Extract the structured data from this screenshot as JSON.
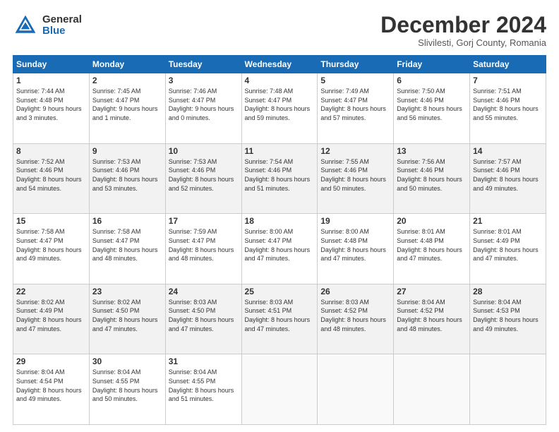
{
  "logo": {
    "general": "General",
    "blue": "Blue"
  },
  "header": {
    "month": "December 2024",
    "location": "Slivilesti, Gorj County, Romania"
  },
  "weekdays": [
    "Sunday",
    "Monday",
    "Tuesday",
    "Wednesday",
    "Thursday",
    "Friday",
    "Saturday"
  ],
  "weeks": [
    [
      {
        "day": "1",
        "sunrise": "7:44 AM",
        "sunset": "4:48 PM",
        "daylight": "9 hours and 3 minutes."
      },
      {
        "day": "2",
        "sunrise": "7:45 AM",
        "sunset": "4:47 PM",
        "daylight": "9 hours and 1 minute."
      },
      {
        "day": "3",
        "sunrise": "7:46 AM",
        "sunset": "4:47 PM",
        "daylight": "9 hours and 0 minutes."
      },
      {
        "day": "4",
        "sunrise": "7:48 AM",
        "sunset": "4:47 PM",
        "daylight": "8 hours and 59 minutes."
      },
      {
        "day": "5",
        "sunrise": "7:49 AM",
        "sunset": "4:47 PM",
        "daylight": "8 hours and 57 minutes."
      },
      {
        "day": "6",
        "sunrise": "7:50 AM",
        "sunset": "4:46 PM",
        "daylight": "8 hours and 56 minutes."
      },
      {
        "day": "7",
        "sunrise": "7:51 AM",
        "sunset": "4:46 PM",
        "daylight": "8 hours and 55 minutes."
      }
    ],
    [
      {
        "day": "8",
        "sunrise": "7:52 AM",
        "sunset": "4:46 PM",
        "daylight": "8 hours and 54 minutes."
      },
      {
        "day": "9",
        "sunrise": "7:53 AM",
        "sunset": "4:46 PM",
        "daylight": "8 hours and 53 minutes."
      },
      {
        "day": "10",
        "sunrise": "7:53 AM",
        "sunset": "4:46 PM",
        "daylight": "8 hours and 52 minutes."
      },
      {
        "day": "11",
        "sunrise": "7:54 AM",
        "sunset": "4:46 PM",
        "daylight": "8 hours and 51 minutes."
      },
      {
        "day": "12",
        "sunrise": "7:55 AM",
        "sunset": "4:46 PM",
        "daylight": "8 hours and 50 minutes."
      },
      {
        "day": "13",
        "sunrise": "7:56 AM",
        "sunset": "4:46 PM",
        "daylight": "8 hours and 50 minutes."
      },
      {
        "day": "14",
        "sunrise": "7:57 AM",
        "sunset": "4:46 PM",
        "daylight": "8 hours and 49 minutes."
      }
    ],
    [
      {
        "day": "15",
        "sunrise": "7:58 AM",
        "sunset": "4:47 PM",
        "daylight": "8 hours and 49 minutes."
      },
      {
        "day": "16",
        "sunrise": "7:58 AM",
        "sunset": "4:47 PM",
        "daylight": "8 hours and 48 minutes."
      },
      {
        "day": "17",
        "sunrise": "7:59 AM",
        "sunset": "4:47 PM",
        "daylight": "8 hours and 48 minutes."
      },
      {
        "day": "18",
        "sunrise": "8:00 AM",
        "sunset": "4:47 PM",
        "daylight": "8 hours and 47 minutes."
      },
      {
        "day": "19",
        "sunrise": "8:00 AM",
        "sunset": "4:48 PM",
        "daylight": "8 hours and 47 minutes."
      },
      {
        "day": "20",
        "sunrise": "8:01 AM",
        "sunset": "4:48 PM",
        "daylight": "8 hours and 47 minutes."
      },
      {
        "day": "21",
        "sunrise": "8:01 AM",
        "sunset": "4:49 PM",
        "daylight": "8 hours and 47 minutes."
      }
    ],
    [
      {
        "day": "22",
        "sunrise": "8:02 AM",
        "sunset": "4:49 PM",
        "daylight": "8 hours and 47 minutes."
      },
      {
        "day": "23",
        "sunrise": "8:02 AM",
        "sunset": "4:50 PM",
        "daylight": "8 hours and 47 minutes."
      },
      {
        "day": "24",
        "sunrise": "8:03 AM",
        "sunset": "4:50 PM",
        "daylight": "8 hours and 47 minutes."
      },
      {
        "day": "25",
        "sunrise": "8:03 AM",
        "sunset": "4:51 PM",
        "daylight": "8 hours and 47 minutes."
      },
      {
        "day": "26",
        "sunrise": "8:03 AM",
        "sunset": "4:52 PM",
        "daylight": "8 hours and 48 minutes."
      },
      {
        "day": "27",
        "sunrise": "8:04 AM",
        "sunset": "4:52 PM",
        "daylight": "8 hours and 48 minutes."
      },
      {
        "day": "28",
        "sunrise": "8:04 AM",
        "sunset": "4:53 PM",
        "daylight": "8 hours and 49 minutes."
      }
    ],
    [
      {
        "day": "29",
        "sunrise": "8:04 AM",
        "sunset": "4:54 PM",
        "daylight": "8 hours and 49 minutes."
      },
      {
        "day": "30",
        "sunrise": "8:04 AM",
        "sunset": "4:55 PM",
        "daylight": "8 hours and 50 minutes."
      },
      {
        "day": "31",
        "sunrise": "8:04 AM",
        "sunset": "4:55 PM",
        "daylight": "8 hours and 51 minutes."
      },
      null,
      null,
      null,
      null
    ]
  ]
}
